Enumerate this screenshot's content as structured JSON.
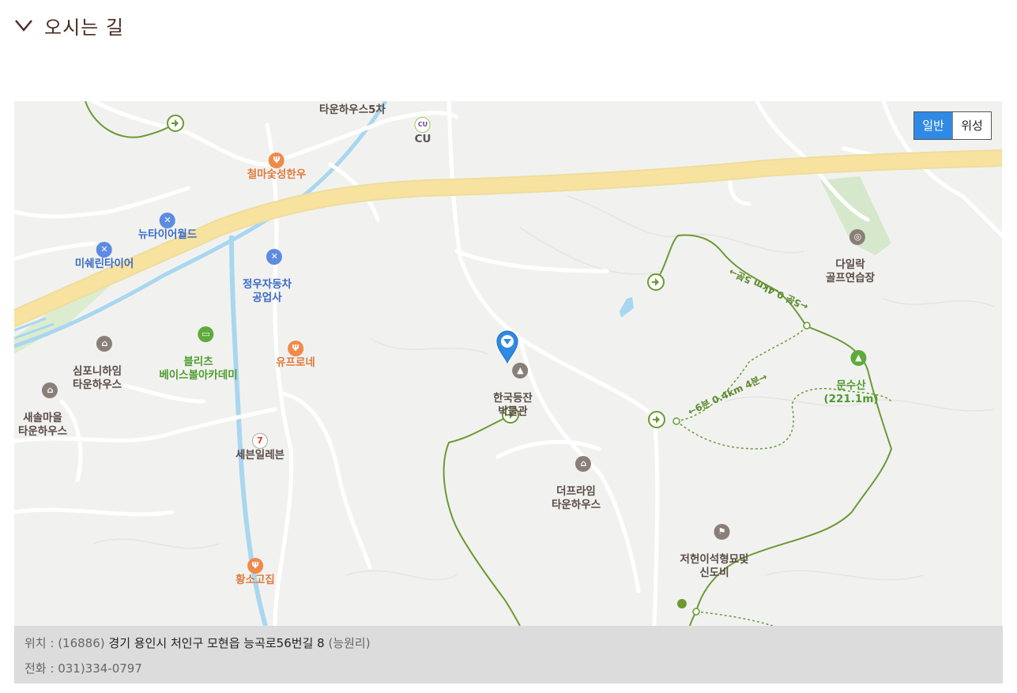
{
  "section": {
    "title": "오시는 길"
  },
  "map_type": {
    "normal": "일반",
    "satellite": "위성",
    "active": "normal"
  },
  "pois": [
    {
      "label": "타운하우스5차",
      "color": "#5a4a44",
      "icon": "home-icon"
    },
    {
      "label": "CU",
      "color": "#555555",
      "icon": "cu-store-icon"
    },
    {
      "label": "철마숯성한우",
      "color": "#e07a3c",
      "icon": "restaurant-icon"
    },
    {
      "label": "뉴타이어월드",
      "color": "#3c6cc8",
      "icon": "car-repair-icon"
    },
    {
      "label": "미쉐린타이어",
      "color": "#3c6cc8",
      "icon": "car-repair-icon"
    },
    {
      "label": "정우자동차\n공업사",
      "color": "#3c6cc8",
      "icon": "car-repair-icon"
    },
    {
      "label": "심포니하임\n타운하우스",
      "color": "#5a4a44",
      "icon": "home-icon"
    },
    {
      "label": "블리츠\n베이스볼아카데미",
      "color": "#4f9a2e",
      "icon": "academy-icon"
    },
    {
      "label": "유프로네",
      "color": "#e07a3c",
      "icon": "restaurant-icon"
    },
    {
      "label": "새솔마을\n타운하우스",
      "color": "#5a4a44",
      "icon": "home-icon"
    },
    {
      "label": "한국등잔\n박물관",
      "color": "#5a4a44",
      "icon": "museum-icon"
    },
    {
      "label": "세븐일레븐",
      "color": "#5a4a44",
      "icon": "seven-eleven-icon"
    },
    {
      "label": "더프라임\n타운하우스",
      "color": "#5a4a44",
      "icon": "home-icon"
    },
    {
      "label": "다일락\n골프연습장",
      "color": "#5a4a44",
      "icon": "golf-icon"
    },
    {
      "label": "문수산\n(221.1m)",
      "color": "#4f9a2e",
      "icon": "mountain-icon"
    },
    {
      "label": "저헌이석형묘및\n신도비",
      "color": "#5a4a44",
      "icon": "landmark-icon"
    },
    {
      "label": "황소고집",
      "color": "#e07a3c",
      "icon": "restaurant-icon"
    }
  ],
  "trails": [
    {
      "label": "←6분 0.4km 4분→"
    },
    {
      "label": "←5분 0.4km 5분→"
    }
  ],
  "colors": {
    "marker": "#2f8ae5",
    "highway": "#f8e2a0",
    "river": "#a9d6f0",
    "trail": "#6b9a33"
  },
  "info": {
    "location_label": "위치 : (16886)",
    "address": "경기 용인시 처인구 모현읍 능곡로56번길 8",
    "address_suffix": "(능원리)",
    "phone_label": "전화 : 031)334-0797"
  }
}
